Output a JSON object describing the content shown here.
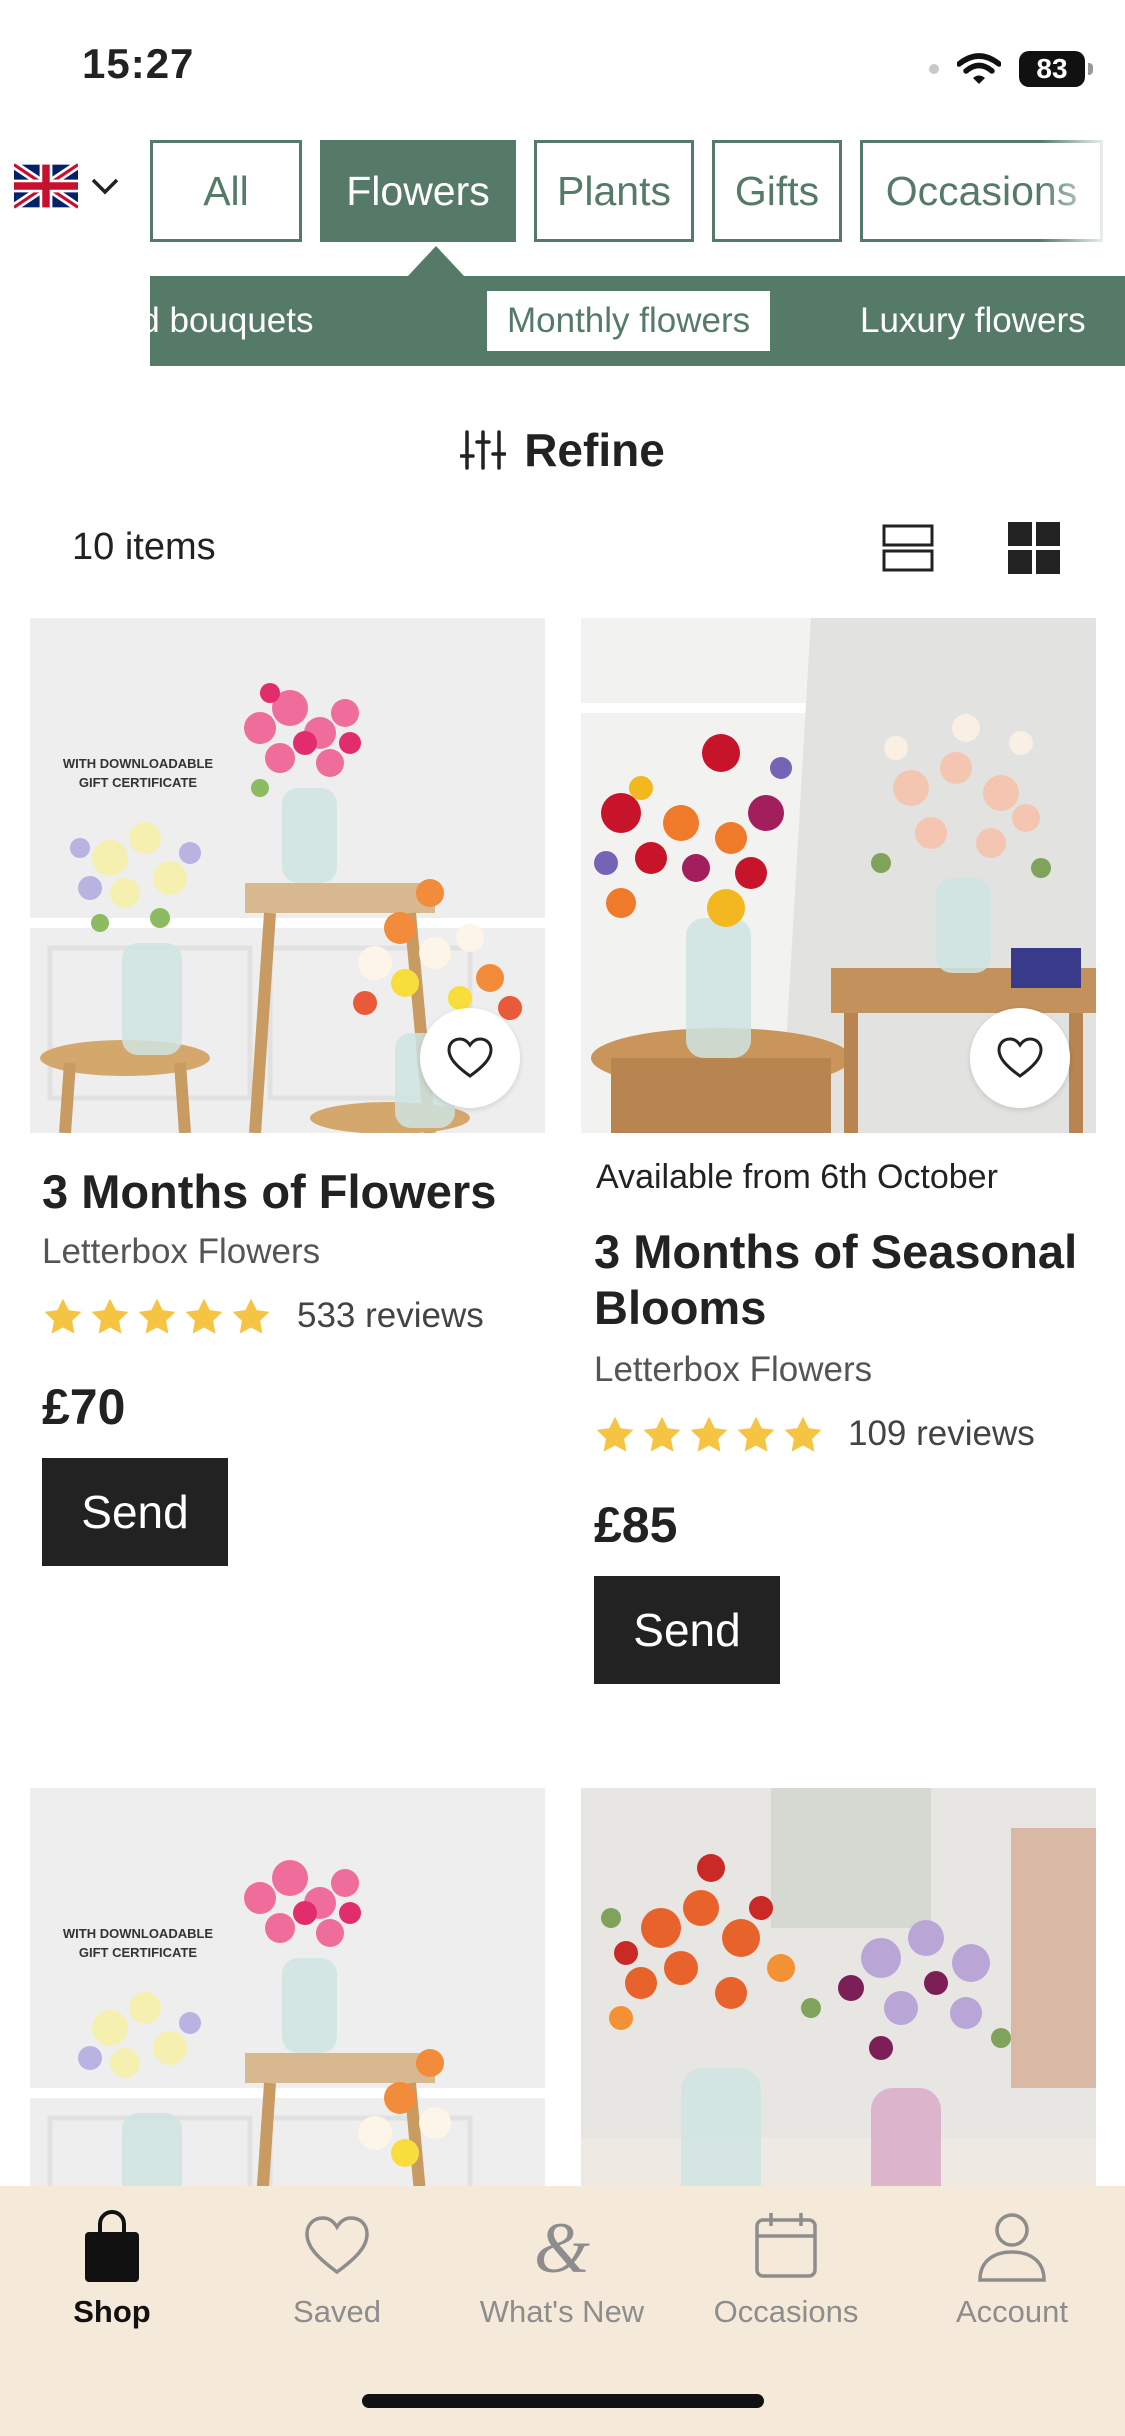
{
  "status_bar": {
    "time": "15:27",
    "battery": "83"
  },
  "categories": [
    {
      "label": "All",
      "active": false
    },
    {
      "label": "Flowers",
      "active": true
    },
    {
      "label": "Plants",
      "active": false
    },
    {
      "label": "Gifts",
      "active": false
    },
    {
      "label": "Occasions",
      "active": false
    }
  ],
  "subcategories": [
    {
      "label": "Hand-tied bouquets",
      "active": false
    },
    {
      "label": "Monthly flowers",
      "active": true
    },
    {
      "label": "Luxury flowers",
      "active": false
    }
  ],
  "refine_label": "Refine",
  "item_count": "10 items",
  "products": [
    {
      "image_badge": "WITH DOWNLOADABLE\nGIFT CERTIFICATE",
      "title": "3 Months of Flowers",
      "brand": "Letterbox Flowers",
      "rating": 5,
      "reviews": "533 reviews",
      "price": "£70",
      "cta": "Send"
    },
    {
      "availability": "Available from 6th October",
      "title": "3 Months of Seasonal Blooms",
      "brand": "Letterbox Flowers",
      "rating": 5,
      "reviews": "109 reviews",
      "price": "£85",
      "cta": "Send"
    },
    {
      "image_badge": "WITH DOWNLOADABLE\nGIFT CERTIFICATE"
    },
    {}
  ],
  "nav": [
    {
      "label": "Shop",
      "icon": "shopping-bag-icon",
      "active": true
    },
    {
      "label": "Saved",
      "icon": "heart-icon",
      "active": false
    },
    {
      "label": "What's New",
      "icon": "ampersand-logo-icon",
      "active": false
    },
    {
      "label": "Occasions",
      "icon": "calendar-icon",
      "active": false
    },
    {
      "label": "Account",
      "icon": "user-icon",
      "active": false
    }
  ],
  "colors": {
    "brand_green": "#557b68",
    "star": "#f6c443",
    "nav_bg": "#f5ead9",
    "button": "#222222"
  }
}
